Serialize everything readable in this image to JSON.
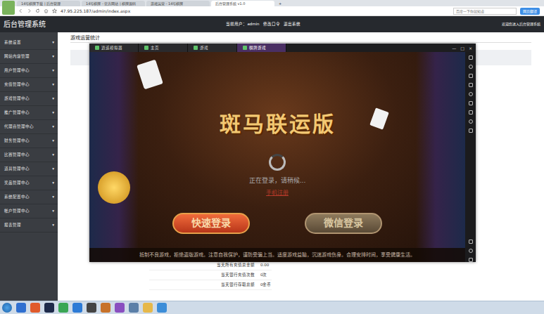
{
  "browser": {
    "tabs": [
      {
        "label": "14号棋牌下载 | 后台管理",
        "selected": false
      },
      {
        "label": "14号棋牌 - 官方网站 | 棋牌源码",
        "selected": false
      },
      {
        "label": "游戏运营 - 14号棋牌",
        "selected": false
      },
      {
        "label": "后台管理系统 v1.0",
        "selected": true
      }
    ],
    "new_tab": "+",
    "address": "47.95.225.187/admin/index.aspx",
    "search_placeholder": "百度一下你就知道",
    "translate": "网页翻译"
  },
  "admin": {
    "title": "后台管理系统",
    "user_label": "当前用户：admin",
    "links": [
      "修改口令",
      "退出系统"
    ],
    "welcome": "欢迎您进入后台管理系统",
    "arrow": "▾",
    "sidebar": [
      "系统设置",
      "网站内容管理",
      "用户管理中心",
      "充值管理中心",
      "游戏管理中心",
      "推广管理中心",
      "代理商管理中心",
      "财务管理中心",
      "比赛管理中心",
      "道具管理中心",
      "奖品管理中心",
      "系统配置中心",
      "帐户管理中心",
      "报表管理"
    ],
    "content_title": "游戏运营统计",
    "stats": [
      {
        "label": "当天所有充值总金额",
        "value": "0.00"
      },
      {
        "label": "当天银行充值次数",
        "value": "0次"
      },
      {
        "label": "当天银行存取总额",
        "value": "0金币"
      }
    ]
  },
  "emulator": {
    "tabs": [
      {
        "label": "逍遥模拟器",
        "selected": false
      },
      {
        "label": "主页",
        "selected": false
      },
      {
        "label": "游戏",
        "selected": false
      },
      {
        "label": "棋牌游戏",
        "selected": true
      }
    ],
    "controls": [
      "—",
      "□",
      "×"
    ],
    "game": {
      "title": "斑马联运版",
      "status": "正在登录，请稍候...",
      "register": "手机注册",
      "buttons": [
        "快速登录",
        "微信登录"
      ],
      "notice": "抵制不良游戏，拒绝盗版游戏。注意自我保护，谨防受骗上当。适度游戏益脑，沉迷游戏伤身。合理安排时间，享受健康生活。"
    }
  }
}
